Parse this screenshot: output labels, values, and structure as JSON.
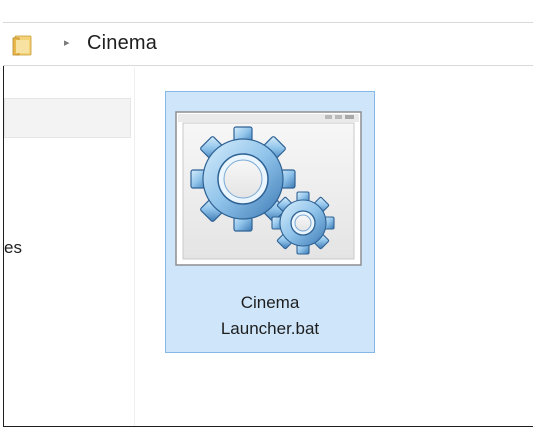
{
  "addressbar": {
    "separator_glyph": "▸",
    "current_folder": "Cinema"
  },
  "navigation": {
    "visible_label": "es"
  },
  "content": {
    "file": {
      "name_line1": "Cinema",
      "name_line2": "Launcher.bat",
      "icon": "batch-file-gears-icon"
    }
  },
  "colors": {
    "selection_fill": "#cfe6fa",
    "selection_border": "#85b8e6",
    "folder_yellow": "#e8c25a"
  }
}
